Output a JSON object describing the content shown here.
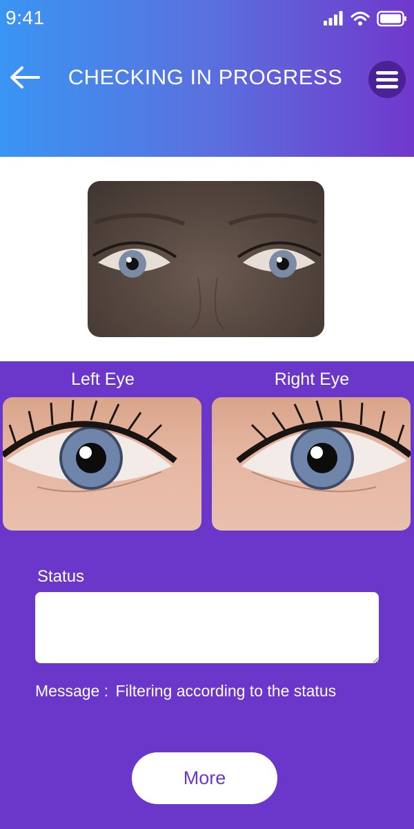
{
  "status_bar": {
    "time": "9:41",
    "icons": [
      "signal-icon",
      "wifi-icon",
      "battery-icon"
    ]
  },
  "header": {
    "title": "CHECKING IN PROGRESS",
    "back_icon": "arrow-left-icon",
    "menu_icon": "hamburger-menu-icon"
  },
  "eyes": {
    "left_label": "Left Eye",
    "right_label": "Right Eye"
  },
  "status": {
    "label": "Status",
    "value": ""
  },
  "message": {
    "prefix": "Message :",
    "text": "Filtering according to the status"
  },
  "more_button": {
    "label": "More"
  },
  "colors": {
    "header_start": "#3a95f3",
    "header_end": "#7038cc",
    "background": "#6b37cb",
    "menu_button": "#4b2295"
  }
}
